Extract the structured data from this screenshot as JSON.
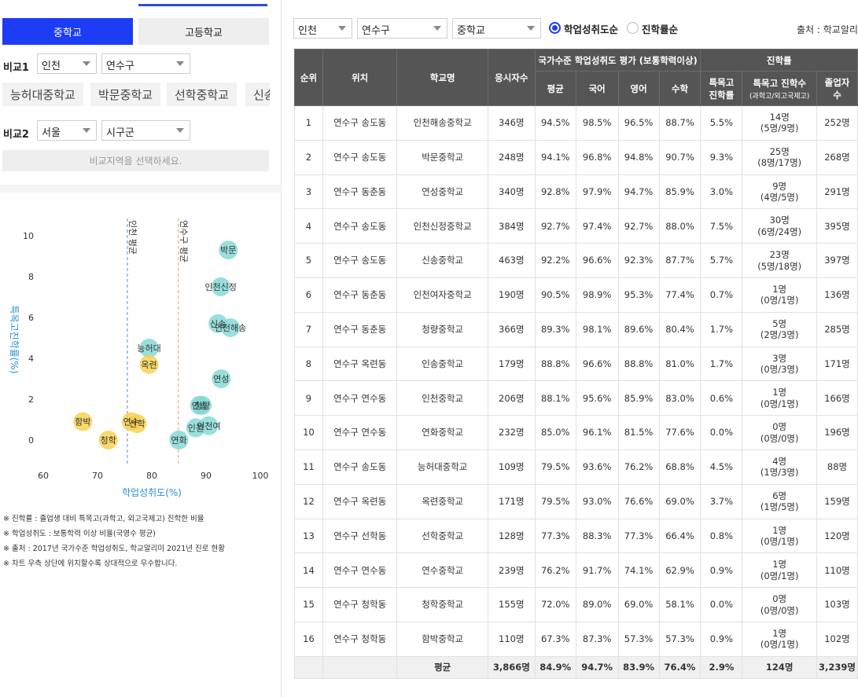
{
  "left": {
    "tabs": {
      "middle": "중학교",
      "high": "고등학교"
    },
    "compare1": {
      "label": "비교1",
      "region": "인천",
      "district": "연수구"
    },
    "chips": [
      "능허대중학교",
      "박문중학교",
      "선학중학교",
      "신송"
    ],
    "compare2": {
      "label": "비교2",
      "region": "서울",
      "district": "시구군"
    },
    "hint": "비교지역을 선택하세요.",
    "notes": [
      "※ 진학률 : 졸업생 대비 특목고(과학고, 외고국제고) 진학한 비율",
      "※ 학업성취도 : 보통학력 이상 비율(국영수 평균)",
      "※ 출처 : 2017년 국가수준 학업성취도, 학교알리미 2021년 진로 현황",
      "※ 차트 우측 상단에 위치할수록 상대적으로 우수합니다."
    ]
  },
  "chart_data": {
    "type": "scatter",
    "xlabel": "학업성취도(%)",
    "ylabel": "특목고진학률(%)",
    "xlim": [
      60,
      100
    ],
    "ylim": [
      0,
      10
    ],
    "xticks": [
      "60",
      "70",
      "80",
      "90",
      "100"
    ],
    "yticks": [
      "0",
      "2",
      "4",
      "6",
      "8",
      "10"
    ],
    "reference_lines": [
      {
        "label": "인천 평균",
        "x": 75.5,
        "color": "#5b8fd6"
      },
      {
        "label": "연수구 평균",
        "x": 84.9,
        "color": "#f0a050"
      }
    ],
    "series": [
      {
        "color": "#7fd7d3",
        "points": [
          {
            "label": "박문",
            "x": 94.1,
            "y": 9.3
          },
          {
            "label": "인천신정",
            "x": 92.7,
            "y": 7.5
          },
          {
            "label": "신송",
            "x": 92.2,
            "y": 5.7
          },
          {
            "label": "인천해송",
            "x": 94.5,
            "y": 5.5
          },
          {
            "label": "능허대",
            "x": 79.5,
            "y": 4.5
          },
          {
            "label": "연성",
            "x": 92.8,
            "y": 3.0
          },
          {
            "label": "청량",
            "x": 89.3,
            "y": 1.7
          },
          {
            "label": "인송",
            "x": 88.8,
            "y": 1.7
          },
          {
            "label": "인천",
            "x": 88.1,
            "y": 0.6
          },
          {
            "label": "인천여",
            "x": 90.5,
            "y": 0.7
          },
          {
            "label": "연화",
            "x": 85.0,
            "y": 0.0
          }
        ]
      },
      {
        "color": "#f7d04a",
        "points": [
          {
            "label": "옥련",
            "x": 79.5,
            "y": 3.7
          },
          {
            "label": "함박",
            "x": 67.3,
            "y": 0.9
          },
          {
            "label": "연수",
            "x": 76.2,
            "y": 0.9
          },
          {
            "label": "선학",
            "x": 77.3,
            "y": 0.8
          },
          {
            "label": "청학",
            "x": 72.0,
            "y": 0.0
          }
        ]
      }
    ]
  },
  "right": {
    "filters": {
      "region": "인천",
      "district": "연수구",
      "level": "중학교"
    },
    "sort": {
      "achievement": "학업성취도순",
      "advancement": "진학률순",
      "selected": "achievement"
    },
    "source": "출처 : 학교알리미",
    "headers": {
      "rank": "순위",
      "location": "위치",
      "school": "학교명",
      "examinees": "응시자수",
      "assessment": "국가수준 학업성취도 평가 (보통학력이상)",
      "avg": "평균",
      "korean": "국어",
      "english": "영어",
      "math": "수학",
      "advancement": "진학률",
      "special_rate_1": "특목고",
      "special_rate_2": "진학률",
      "special_count": "특목고 진학수",
      "special_count_sub": "(과학고/외고국제고)",
      "graduates_1": "졸업자",
      "graduates_2": "수"
    },
    "rows": [
      {
        "rank": "1",
        "loc": "연수구 송도동",
        "name": "인천해송중학교",
        "n": "346명",
        "avg": "94.5%",
        "kor": "98.5%",
        "eng": "96.5%",
        "math": "88.7%",
        "rate": "5.5%",
        "cnt": "14명",
        "cnt_sub": "(5명/9명)",
        "grad": "252명"
      },
      {
        "rank": "2",
        "loc": "연수구 송도동",
        "name": "박문중학교",
        "n": "248명",
        "avg": "94.1%",
        "kor": "96.8%",
        "eng": "94.8%",
        "math": "90.7%",
        "rate": "9.3%",
        "cnt": "25명",
        "cnt_sub": "(8명/17명)",
        "grad": "268명"
      },
      {
        "rank": "3",
        "loc": "연수구 동춘동",
        "name": "연성중학교",
        "n": "340명",
        "avg": "92.8%",
        "kor": "97.9%",
        "eng": "94.7%",
        "math": "85.9%",
        "rate": "3.0%",
        "cnt": "9명",
        "cnt_sub": "(4명/5명)",
        "grad": "291명"
      },
      {
        "rank": "4",
        "loc": "연수구 송도동",
        "name": "인천신정중학교",
        "n": "384명",
        "avg": "92.7%",
        "kor": "97.4%",
        "eng": "92.7%",
        "math": "88.0%",
        "rate": "7.5%",
        "cnt": "30명",
        "cnt_sub": "(6명/24명)",
        "grad": "395명"
      },
      {
        "rank": "5",
        "loc": "연수구 송도동",
        "name": "신송중학교",
        "n": "463명",
        "avg": "92.2%",
        "kor": "96.6%",
        "eng": "92.3%",
        "math": "87.7%",
        "rate": "5.7%",
        "cnt": "23명",
        "cnt_sub": "(5명/18명)",
        "grad": "397명"
      },
      {
        "rank": "6",
        "loc": "연수구 동춘동",
        "name": "인천여자중학교",
        "n": "190명",
        "avg": "90.5%",
        "kor": "98.9%",
        "eng": "95.3%",
        "math": "77.4%",
        "rate": "0.7%",
        "cnt": "1명",
        "cnt_sub": "(0명/1명)",
        "grad": "136명"
      },
      {
        "rank": "7",
        "loc": "연수구 동춘동",
        "name": "청량중학교",
        "n": "366명",
        "avg": "89.3%",
        "kor": "98.1%",
        "eng": "89.6%",
        "math": "80.4%",
        "rate": "1.7%",
        "cnt": "5명",
        "cnt_sub": "(2명/3명)",
        "grad": "285명"
      },
      {
        "rank": "8",
        "loc": "연수구 옥련동",
        "name": "인송중학교",
        "n": "179명",
        "avg": "88.8%",
        "kor": "96.6%",
        "eng": "88.8%",
        "math": "81.0%",
        "rate": "1.7%",
        "cnt": "3명",
        "cnt_sub": "(0명/3명)",
        "grad": "171명"
      },
      {
        "rank": "9",
        "loc": "연수구 연수동",
        "name": "인천중학교",
        "n": "206명",
        "avg": "88.1%",
        "kor": "95.6%",
        "eng": "85.9%",
        "math": "83.0%",
        "rate": "0.6%",
        "cnt": "1명",
        "cnt_sub": "(0명/1명)",
        "grad": "166명"
      },
      {
        "rank": "10",
        "loc": "연수구 연수동",
        "name": "연화중학교",
        "n": "232명",
        "avg": "85.0%",
        "kor": "96.1%",
        "eng": "81.5%",
        "math": "77.6%",
        "rate": "0.0%",
        "cnt": "0명",
        "cnt_sub": "(0명/0명)",
        "grad": "196명"
      },
      {
        "rank": "11",
        "loc": "연수구 송도동",
        "name": "능허대중학교",
        "n": "109명",
        "avg": "79.5%",
        "kor": "93.6%",
        "eng": "76.2%",
        "math": "68.8%",
        "rate": "4.5%",
        "cnt": "4명",
        "cnt_sub": "(1명/3명)",
        "grad": "88명"
      },
      {
        "rank": "12",
        "loc": "연수구 옥련동",
        "name": "옥련중학교",
        "n": "171명",
        "avg": "79.5%",
        "kor": "93.0%",
        "eng": "76.6%",
        "math": "69.0%",
        "rate": "3.7%",
        "cnt": "6명",
        "cnt_sub": "(1명/5명)",
        "grad": "159명"
      },
      {
        "rank": "13",
        "loc": "연수구 선학동",
        "name": "선학중학교",
        "n": "128명",
        "avg": "77.3%",
        "kor": "88.3%",
        "eng": "77.3%",
        "math": "66.4%",
        "rate": "0.8%",
        "cnt": "1명",
        "cnt_sub": "(0명/1명)",
        "grad": "120명"
      },
      {
        "rank": "14",
        "loc": "연수구 연수동",
        "name": "연수중학교",
        "n": "239명",
        "avg": "76.2%",
        "kor": "91.7%",
        "eng": "74.1%",
        "math": "62.9%",
        "rate": "0.9%",
        "cnt": "1명",
        "cnt_sub": "(0명/1명)",
        "grad": "110명"
      },
      {
        "rank": "15",
        "loc": "연수구 청학동",
        "name": "청학중학교",
        "n": "155명",
        "avg": "72.0%",
        "kor": "89.0%",
        "eng": "69.0%",
        "math": "58.1%",
        "rate": "0.0%",
        "cnt": "0명",
        "cnt_sub": "(0명/0명)",
        "grad": "103명"
      },
      {
        "rank": "16",
        "loc": "연수구 청학동",
        "name": "함박중학교",
        "n": "110명",
        "avg": "67.3%",
        "kor": "87.3%",
        "eng": "57.3%",
        "math": "57.3%",
        "rate": "0.9%",
        "cnt": "1명",
        "cnt_sub": "(0명/1명)",
        "grad": "102명"
      }
    ],
    "footer": {
      "label": "평균",
      "n": "3,866명",
      "avg": "84.9%",
      "kor": "94.7%",
      "eng": "83.9%",
      "math": "76.4%",
      "rate": "2.9%",
      "cnt": "124명",
      "grad": "3,239명"
    }
  }
}
